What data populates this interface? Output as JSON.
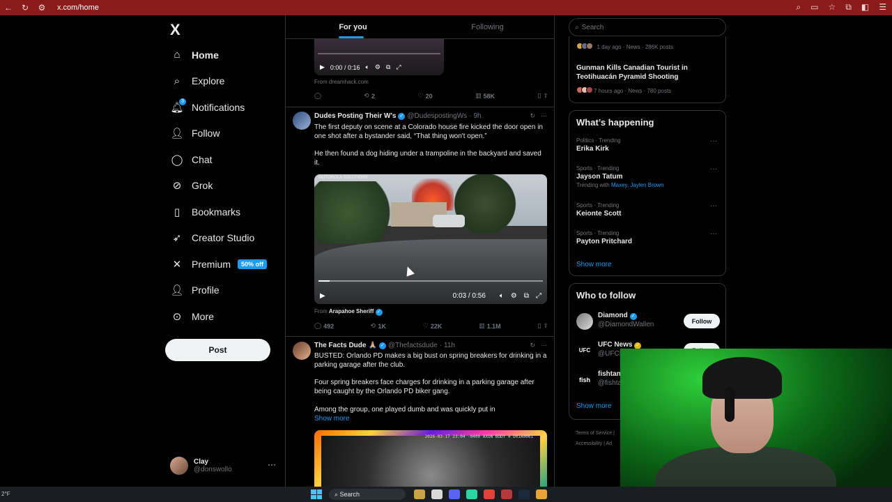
{
  "browser": {
    "url": "x.com/home",
    "nav_icons": [
      "arrow-left-icon",
      "reload-icon",
      "site-info-icon"
    ]
  },
  "sidebar": {
    "logo": "X",
    "items": [
      {
        "label": "Home",
        "icon": "home-icon"
      },
      {
        "label": "Explore",
        "icon": "search-icon"
      },
      {
        "label": "Notifications",
        "icon": "bell-icon",
        "badge": "3"
      },
      {
        "label": "Follow",
        "icon": "person-plus-icon"
      },
      {
        "label": "Chat",
        "icon": "chat-icon"
      },
      {
        "label": "Grok",
        "icon": "grok-icon"
      },
      {
        "label": "Bookmarks",
        "icon": "bookmark-icon"
      },
      {
        "label": "Creator Studio",
        "icon": "rocket-icon"
      },
      {
        "label": "Premium",
        "icon": "x-icon",
        "badge": "50% off"
      },
      {
        "label": "Profile",
        "icon": "person-icon"
      },
      {
        "label": "More",
        "icon": "more-circle-icon"
      }
    ],
    "post_label": "Post",
    "account": {
      "name": "Clay",
      "handle": "@donswollo"
    }
  },
  "main": {
    "tabs": [
      {
        "label": "For you",
        "active": true
      },
      {
        "label": "Following",
        "active": false
      }
    ],
    "prev_tweet": {
      "video_time": "0:00 / 0:16",
      "from": "From dreamhack.com",
      "actions": {
        "replies": "",
        "reposts": "2",
        "likes": "20",
        "views": "58K"
      }
    },
    "tweets": [
      {
        "name": "Dudes Posting Their W's",
        "handle": "@DudespostingWs",
        "time": "9h",
        "text1": "The first deputy on scene at a Colorado house fire kicked the door open in one shot after a bystander said, “That thing won't open.”",
        "text2": "He then found a dog hiding under a trampoline in the backyard and saved it.",
        "video": {
          "brand": "MOTOROLA SOLUTIONS",
          "time": "0:03 / 0:56",
          "progress": 0.05
        },
        "from_prefix": "From",
        "from_source": "Arapahoe Sheriff",
        "actions": {
          "replies": "492",
          "reposts": "1K",
          "likes": "22K",
          "views": "1.1M"
        }
      },
      {
        "name": "The Facts Dude",
        "emoji": "🙏🏼",
        "handle": "@Thefactsdude",
        "time": "11h",
        "text1": "BUSTED: Orlando PD makes a big bust on spring breakers for drinking in a parking garage after the club.",
        "text2": "Four spring breakers face charges for drinking in a parking garage after being caught by the Orlando PD biker gang.",
        "text3": "Among the group, one played dumb and was quickly put in",
        "show_more": "Show more",
        "media_stamp": "2026-03-17 23:04 -0400 AXON BODY 4 D01A0061"
      }
    ]
  },
  "right": {
    "search_placeholder": "Search",
    "news": [
      {
        "meta": "1 day ago · News · 286K posts"
      },
      {
        "title": "Gunman Kills Canadian Tourist in Teotihuacán Pyramid Shooting",
        "meta": "7 hours ago · News · 780 posts"
      }
    ],
    "whats_happening": {
      "title": "What’s happening",
      "trends": [
        {
          "category": "Politics · Trending",
          "name": "Erika Kirk"
        },
        {
          "category": "Sports · Trending",
          "name": "Jayson Tatum",
          "with_prefix": "Trending with",
          "with_links": "Maxey, Jaylen Brown"
        },
        {
          "category": "Sports · Trending",
          "name": "Keionte Scott"
        },
        {
          "category": "Sports · Trending",
          "name": "Payton Pritchard"
        }
      ],
      "show_more": "Show more"
    },
    "who_to_follow": {
      "title": "Who to follow",
      "accounts": [
        {
          "name": "Diamond",
          "handle": "@DiamondWallen",
          "button": "Follow"
        },
        {
          "name": "UFC News",
          "handle": "@UFCN",
          "button": "Follow",
          "logo": "UFC"
        },
        {
          "name": "fishtan",
          "handle": "@fishta",
          "logo": "fish"
        }
      ],
      "show_more": "Show more"
    },
    "footer": {
      "line1": "Terms of Service  |",
      "line2": "Accessibility  |  Ad"
    }
  },
  "taskbar": {
    "temp": "2°F",
    "search": "Search"
  }
}
